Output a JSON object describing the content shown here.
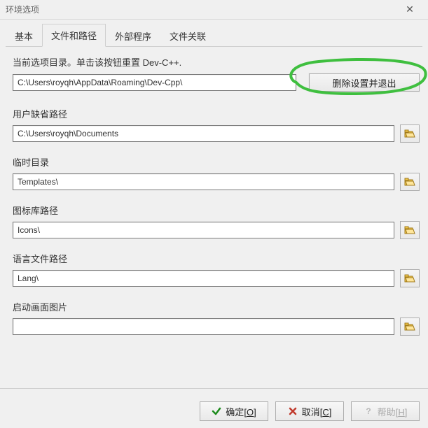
{
  "window": {
    "title": "环境选项"
  },
  "tabs": {
    "items": [
      {
        "label": "基本"
      },
      {
        "label": "文件和路径"
      },
      {
        "label": "外部程序"
      },
      {
        "label": "文件关联"
      }
    ],
    "active_index": 1
  },
  "top": {
    "prompt": "当前选项目录。单击该按钮重置 Dev-C++.",
    "path": "C:\\Users\\royqh\\AppData\\Roaming\\Dev-Cpp\\",
    "delete_label": "删除设置并退出"
  },
  "sections": [
    {
      "label": "用户缺省路径",
      "value": "C:\\Users\\royqh\\Documents"
    },
    {
      "label": "临时目录",
      "value": "Templates\\"
    },
    {
      "label": "图标库路径",
      "value": "Icons\\"
    },
    {
      "label": "语言文件路径",
      "value": "Lang\\"
    },
    {
      "label": "启动画面图片",
      "value": ""
    }
  ],
  "buttons": {
    "ok": {
      "text": "确定",
      "mnemonic": "O"
    },
    "cancel": {
      "text": "取消",
      "mnemonic": "C"
    },
    "help": {
      "text": "帮助",
      "mnemonic": "H"
    }
  },
  "icons": {
    "close": "✕"
  },
  "annotation": {
    "color": "#3fbf3f"
  }
}
